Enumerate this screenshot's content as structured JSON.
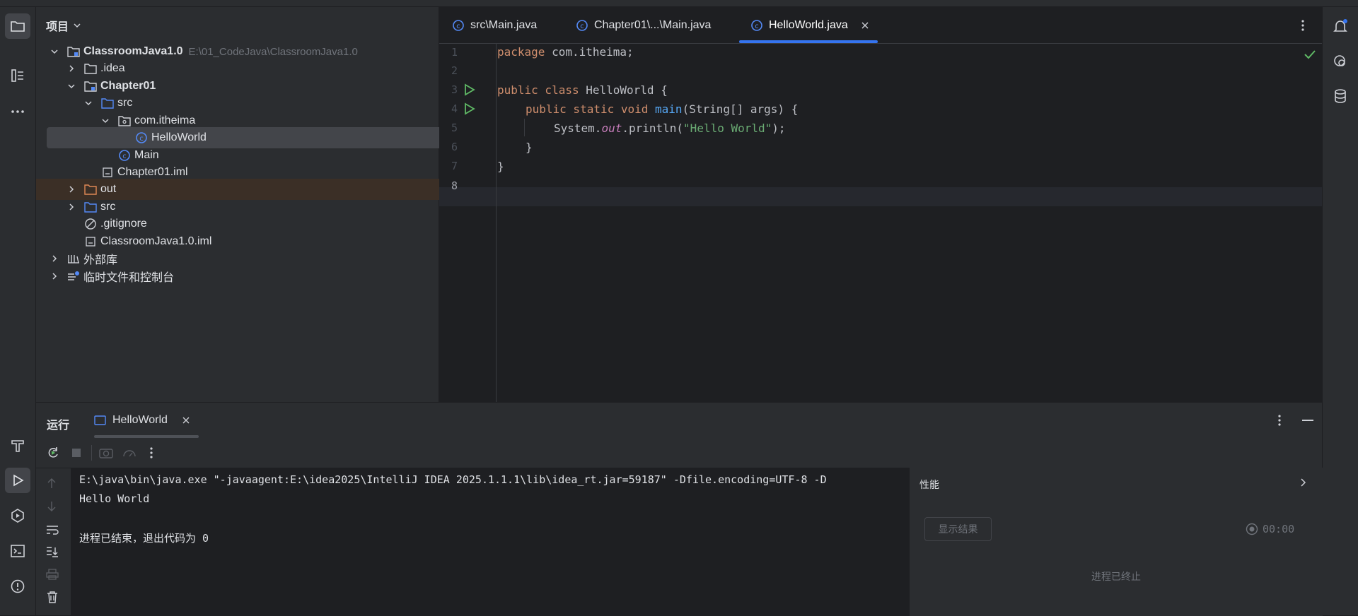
{
  "project": {
    "header": "项目",
    "tree": [
      {
        "label": "ClassroomJava1.0",
        "path": "E:\\01_CodeJava\\ClassroomJava1.0"
      },
      {
        "label": ".idea"
      },
      {
        "label": "Chapter01"
      },
      {
        "label": "src"
      },
      {
        "label": "com.itheima"
      },
      {
        "label": "HelloWorld"
      },
      {
        "label": "Main"
      },
      {
        "label": "Chapter01.iml"
      },
      {
        "label": "out"
      },
      {
        "label": "src"
      },
      {
        "label": ".gitignore"
      },
      {
        "label": "ClassroomJava1.0.iml"
      },
      {
        "label": "外部库"
      },
      {
        "label": "临时文件和控制台"
      }
    ]
  },
  "editor": {
    "tabs": [
      {
        "label": "src\\Main.java"
      },
      {
        "label": "Chapter01\\...\\Main.java"
      },
      {
        "label": "HelloWorld.java"
      }
    ],
    "line_numbers": [
      "1",
      "2",
      "3",
      "4",
      "5",
      "6",
      "7",
      "8"
    ],
    "code": {
      "l1_kw": "package",
      "l1_rest": " com.itheima;",
      "l3_kw": "public class",
      "l3_rest": " HelloWorld {",
      "l4_kw": "public static void",
      "l4_fn": "main",
      "l4_rest": "(String[] args) {",
      "l5_a": "System.",
      "l5_out": "out",
      "l5_b": ".println(",
      "l5_str": "\"Hello World\"",
      "l5_c": ");",
      "l6": "}",
      "l7": "}"
    }
  },
  "run": {
    "title": "运行",
    "tab_label": "HelloWorld",
    "console_lines": [
      "E:\\java\\bin\\java.exe \"-javaagent:E:\\idea2025\\IntelliJ IDEA 2025.1.1.1\\lib\\idea_rt.jar=59187\" -Dfile.encoding=UTF-8 -D",
      "Hello World",
      "",
      "进程已结束，退出代码为 0"
    ],
    "perf": {
      "title": "性能",
      "show_results": "显示结果",
      "timer": "00:00",
      "status": "进程已终止"
    }
  },
  "colors": {
    "accent": "#3574f0",
    "run_green": "#5fb865",
    "folder_blue": "#548af7"
  }
}
